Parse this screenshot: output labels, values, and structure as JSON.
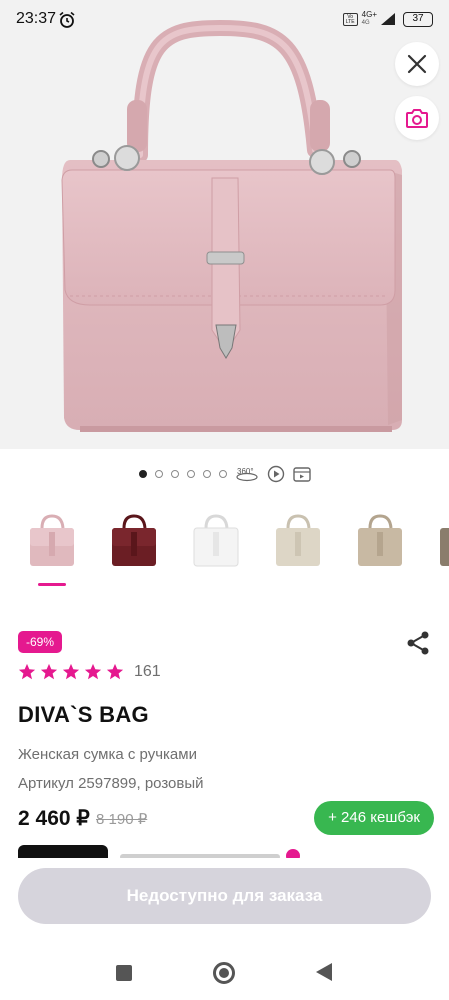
{
  "status_bar": {
    "time": "23:37",
    "network": "4G+",
    "network_sub": "4G",
    "volte": "Vo LTE",
    "battery": "37"
  },
  "hero": {
    "product_color": "#e0b9be",
    "background": "#f2f2f2",
    "close_icon": "close-icon",
    "camera_icon": "camera-icon"
  },
  "gallery": {
    "dots_count": 6,
    "active_index": 0,
    "view_360_label": "360°"
  },
  "thumbnails": [
    {
      "color": "#e0b9be",
      "selected": true
    },
    {
      "color": "#6b1e24",
      "selected": false
    },
    {
      "color": "#f4f4f4",
      "selected": false
    },
    {
      "color": "#ddd6c6",
      "selected": false
    },
    {
      "color": "#c8b9a3",
      "selected": false
    },
    {
      "color": "#8a7d6c",
      "selected": false
    }
  ],
  "product": {
    "discount": "-69%",
    "rating_stars": 5,
    "reviews_count": "161",
    "brand": "DIVA`S BAG",
    "name": "Женская сумка с ручками",
    "article": "Артикул 2597899, розовый",
    "price": "2 460 ₽",
    "old_price": "8 190 ₽",
    "cashback": "+ 246 кешбэк"
  },
  "actions": {
    "order_button": "Недоступно для заказа"
  },
  "colors": {
    "accent": "#e5198f",
    "cashback": "#38b750",
    "disabled_button": "#d6d4dc"
  }
}
